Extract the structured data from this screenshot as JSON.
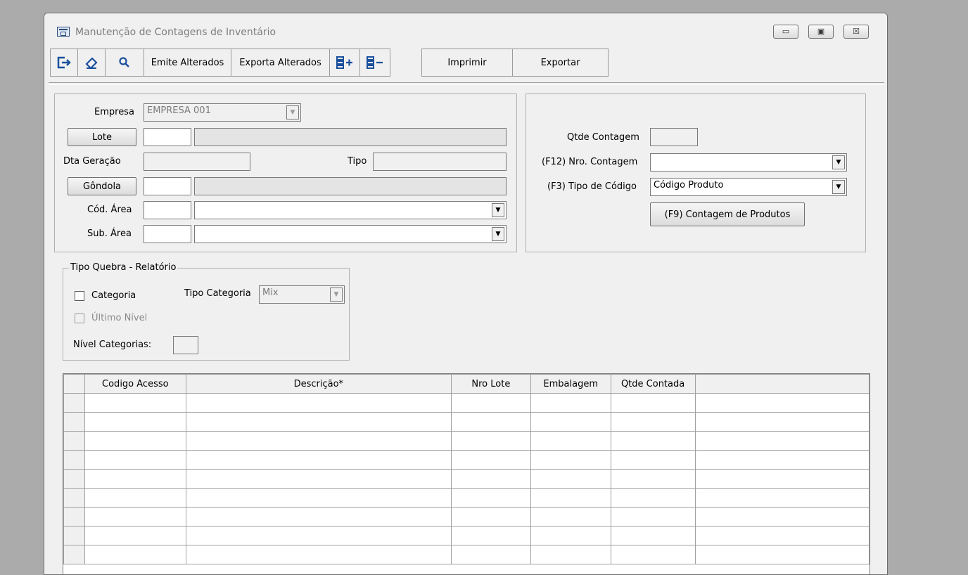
{
  "window": {
    "title": "Manutenção de Contagens de Inventário",
    "controls": {
      "minimize": "▭",
      "maximize": "▣",
      "close": "☒"
    }
  },
  "toolbar": {
    "emite_alterados": "Emite Alterados",
    "exporta_alterados": "Exporta Alterados",
    "imprimir": "Imprimir",
    "exportar": "Exportar"
  },
  "left_panel": {
    "empresa_label": "Empresa",
    "empresa_value": "EMPRESA 001",
    "lote_button": "Lote",
    "dta_geracao_label": "Dta Geração",
    "tipo_label": "Tipo",
    "gondola_button": "Gôndola",
    "cod_area_label": "Cód. Área",
    "sub_area_label": "Sub. Área"
  },
  "right_panel": {
    "qtde_contagem_label": "Qtde Contagem",
    "nro_contagem_label": "(F12) Nro. Contagem",
    "tipo_codigo_label": "(F3) Tipo de Código",
    "tipo_codigo_value": "Código Produto",
    "contagem_produtos_button": "(F9) Contagem de Produtos"
  },
  "quebra": {
    "legend": "Tipo Quebra - Relatório",
    "categoria_label": "Categoria",
    "tipo_categoria_label": "Tipo Categoria",
    "tipo_categoria_value": "Mix",
    "ultimo_nivel_label": "Último Nível",
    "nivel_categorias_label": "Nível Categorias:"
  },
  "grid": {
    "columns": [
      "Codigo Acesso",
      "Descrição*",
      "Nro Lote",
      "Embalagem",
      "Qtde Contada",
      ""
    ],
    "row_count": 9
  }
}
